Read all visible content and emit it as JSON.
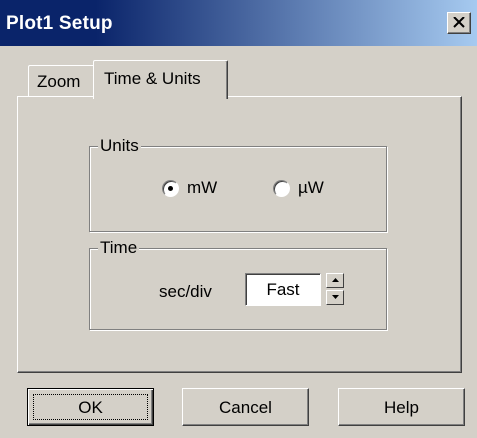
{
  "window": {
    "title": "Plot1 Setup"
  },
  "tabs": [
    {
      "label": "Zoom",
      "active": false
    },
    {
      "label": "Time & Units",
      "active": true
    }
  ],
  "units": {
    "legend": "Units",
    "options": [
      {
        "label": "mW",
        "selected": true
      },
      {
        "label": "µW",
        "selected": false
      }
    ]
  },
  "time": {
    "legend": "Time",
    "secdiv_label": "sec/div",
    "speed_value": "Fast"
  },
  "buttons": {
    "ok": "OK",
    "cancel": "Cancel",
    "help": "Help"
  },
  "icons": {
    "close": "close-icon",
    "spin_up": "arrow-up-icon",
    "spin_down": "arrow-down-icon"
  },
  "colors": {
    "titlebar_start": "#0a246a",
    "titlebar_end": "#a6caf0",
    "face": "#d4d0c8"
  }
}
